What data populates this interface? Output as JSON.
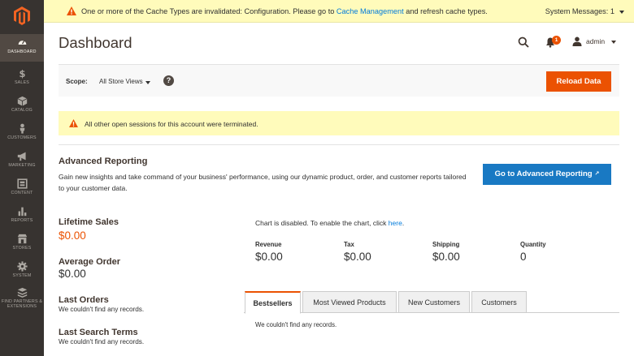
{
  "system_message": {
    "text_before": "One or more of the Cache Types are invalidated: Configuration. Please go to ",
    "link": "Cache Management",
    "text_after": " and refresh cache types.",
    "count_label": "System Messages: 1"
  },
  "sidebar": {
    "items": [
      {
        "label": "DASHBOARD",
        "icon": "speedometer-icon",
        "active": true
      },
      {
        "label": "SALES",
        "icon": "dollar-icon"
      },
      {
        "label": "CATALOG",
        "icon": "box-icon"
      },
      {
        "label": "CUSTOMERS",
        "icon": "person-icon"
      },
      {
        "label": "MARKETING",
        "icon": "megaphone-icon"
      },
      {
        "label": "CONTENT",
        "icon": "content-icon"
      },
      {
        "label": "REPORTS",
        "icon": "bar-chart-icon"
      },
      {
        "label": "STORES",
        "icon": "store-icon"
      },
      {
        "label": "SYSTEM",
        "icon": "gear-icon"
      },
      {
        "label": "FIND PARTNERS & EXTENSIONS",
        "icon": "extensions-icon"
      }
    ]
  },
  "header": {
    "title": "Dashboard",
    "notifications_count": "1",
    "user": "admin"
  },
  "scope": {
    "label": "Scope:",
    "value": "All Store Views",
    "help": "?",
    "reload_label": "Reload Data"
  },
  "notice": {
    "text": "All other open sessions for this account were terminated."
  },
  "advanced_reporting": {
    "title": "Advanced Reporting",
    "description": "Gain new insights and take command of your business' performance, using our dynamic product, order, and customer reports tailored to your customer data.",
    "button_label": "Go to Advanced Reporting"
  },
  "stats": {
    "lifetime_sales_label": "Lifetime Sales",
    "lifetime_sales_value": "$0.00",
    "average_order_label": "Average Order",
    "average_order_value": "$0.00",
    "last_orders_label": "Last Orders",
    "last_orders_empty": "We couldn't find any records.",
    "last_search_label": "Last Search Terms",
    "last_search_empty": "We couldn't find any records."
  },
  "chart": {
    "message": "Chart is disabled. To enable the chart, click ",
    "link": "here",
    "message_end": "."
  },
  "totals": {
    "revenue_label": "Revenue",
    "revenue_value": "$0.00",
    "tax_label": "Tax",
    "tax_value": "$0.00",
    "shipping_label": "Shipping",
    "shipping_value": "$0.00",
    "quantity_label": "Quantity",
    "quantity_value": "0"
  },
  "tabs": {
    "items": [
      "Bestsellers",
      "Most Viewed Products",
      "New Customers",
      "Customers"
    ],
    "empty": "We couldn't find any records."
  },
  "colors": {
    "sidebar": "#373330",
    "accent": "#eb5202",
    "link": "#007bdb",
    "primary_button": "#1979c3",
    "message_bg": "#fffbbb"
  }
}
